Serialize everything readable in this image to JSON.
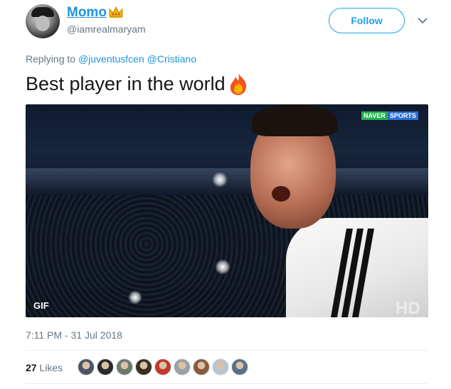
{
  "author": {
    "name": "Momo",
    "handle": "@iamrealmaryam",
    "name_emoji": "crown-icon"
  },
  "actions": {
    "follow_label": "Follow",
    "menu_icon": "chevron-down-icon"
  },
  "reply": {
    "prefix": "Replying to",
    "mentions": [
      "@juventusfcen",
      "@Cristiano"
    ]
  },
  "tweet": {
    "text": "Best player in the world",
    "text_emoji": "fire-icon"
  },
  "media": {
    "badge": "GIF",
    "watermark": "HD",
    "logo_left": "NAVER",
    "logo_right": "SPORTS"
  },
  "meta": {
    "timestamp": "7:11 PM - 31 Jul 2018"
  },
  "engagement": {
    "likes_count": "27",
    "likes_label": "Likes",
    "liker_colors": [
      "#4a5566",
      "#2b2b2b",
      "#6d7a6a",
      "#3a3020",
      "#c0392b",
      "#9aa0a6",
      "#8a5a3a",
      "#b8c4d0",
      "#5b6f8a"
    ]
  },
  "colors": {
    "link": "#1b95e0",
    "follow": "#1da1f2",
    "muted": "#657786"
  }
}
